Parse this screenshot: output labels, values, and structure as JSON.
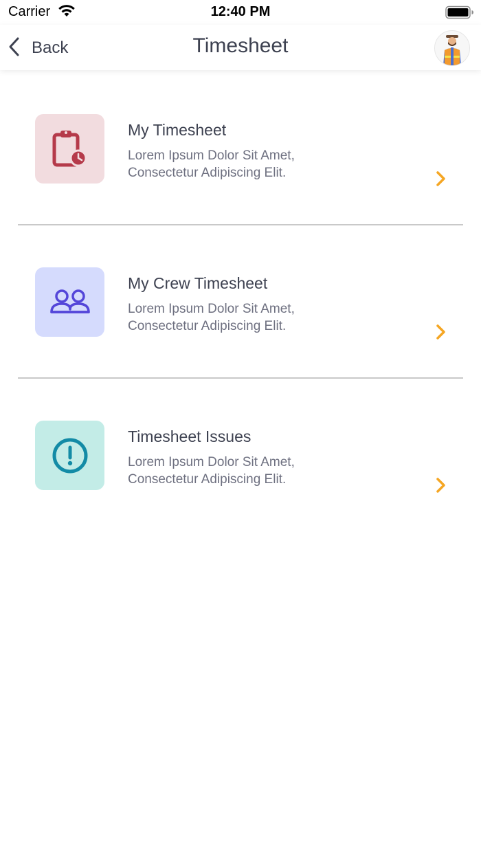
{
  "status_bar": {
    "carrier": "Carrier",
    "time": "12:40 PM"
  },
  "nav": {
    "back_label": "Back",
    "title": "Timesheet"
  },
  "colors": {
    "accent_arrow": "#f5a623",
    "text_primary": "#3d4150",
    "text_secondary": "#6e7080"
  },
  "items": [
    {
      "title": "My Timesheet",
      "description": "Lorem Ipsum Dolor Sit Amet, Consectetur Adipiscing Elit.",
      "icon": "clipboard-clock-icon",
      "tile_color": "#f2dcdf",
      "icon_color": "#b53a4a"
    },
    {
      "title": "My Crew Timesheet",
      "description": "Lorem Ipsum Dolor Sit Amet, Consectetur Adipiscing Elit.",
      "icon": "crew-icon",
      "tile_color": "#d5dbfd",
      "icon_color": "#5446d9"
    },
    {
      "title": "Timesheet Issues",
      "description": "Lorem Ipsum Dolor Sit Amet, Consectetur Adipiscing Elit.",
      "icon": "exclamation-circle-icon",
      "tile_color": "#c3ece7",
      "icon_color": "#138ba6"
    }
  ]
}
